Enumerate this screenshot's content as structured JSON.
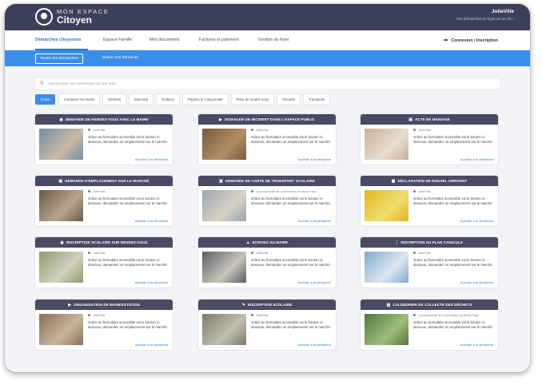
{
  "header": {
    "logo_line1": "MON ESPACE",
    "logo_line2": "Citoyen",
    "town": "JolieVille",
    "town_subtitle": "Vos démarches en ligne en un clic !"
  },
  "nav": {
    "items": [
      "Démarches citoyennes",
      "Espace Famille",
      "Mes documents",
      "Factures et paiement",
      "Gestion du foyer"
    ],
    "active": "Démarches citoyennes",
    "login_label": "Connexion / Inscription"
  },
  "subnav": {
    "tabs": [
      "Toutes les démarches",
      "Suivre une demande"
    ],
    "active": "Toutes les démarches"
  },
  "search": {
    "placeholder": "Rechercher une démarche via son nom"
  },
  "filters": [
    "Toutes",
    "Contacter ma mairie",
    "Déchets",
    "Etat-Civil",
    "Enfance",
    "Papiers et Citoyenneté",
    "Prise de rendez-vous",
    "Sécurité",
    "Transports"
  ],
  "link_label": "Accéder à la démarche",
  "cards": [
    {
      "title": "DEMANDE DE RENDEZ-VOUS AVEC LE MAIRE",
      "icon": "eye-icon",
      "location": "JolieVille",
      "description": "Grâce au formulaire accessible via le bouton ci-dessous, demandez un emplacement sur le marché."
    },
    {
      "title": "SIGNALER UN INCIDENT DANS L'ESPACE PUBLIC",
      "icon": "megaphone-icon",
      "location": "JolieVille",
      "description": "Grâce au formulaire accessible via le bouton ci-dessous, demandez un emplacement sur le marché."
    },
    {
      "title": "ACTE DE MARIAGE",
      "icon": "document-icon",
      "location": "JolieVille",
      "description": "Grâce au formulaire accessible via le bouton ci-dessous, demandez un emplacement sur le marché."
    },
    {
      "title": "DEMANDE D'EMPLACEMENT SUR LE MARCHÉ",
      "icon": "store-icon",
      "location": "JolieVille",
      "description": "Grâce au formulaire accessible via le bouton ci-dessous, demandez un emplacement sur le marché."
    },
    {
      "title": "DEMANDE DE CARTE DE TRANSPORT SCOLAIRE",
      "icon": "bus-icon",
      "location": "Communauté de communes du beau Pays",
      "description": "Grâce au formulaire accessible via le bouton ci-dessous, demandez un emplacement sur le marché."
    },
    {
      "title": "DÉCLARATION DE NOUVEL ARRIVANT",
      "icon": "moving-box-icon",
      "location": "JolieVille",
      "description": "Grâce au formulaire accessible via le bouton ci-dessous, demandez un emplacement sur le marché."
    },
    {
      "title": "INSCRIPTION SCOLAIRE SUR RENDEZ-VOUS",
      "icon": "eye-icon",
      "location": "JolieVille",
      "description": "Grâce au formulaire accessible via le bouton ci-dessous, demandez un emplacement sur le marché."
    },
    {
      "title": "ECRIVEZ AU MAIRE",
      "icon": "townhall-icon",
      "location": "JolieVille",
      "description": "Grâce au formulaire accessible via le bouton ci-dessous, demandez un emplacement sur le marché."
    },
    {
      "title": "INSCRIPTION AU PLAN CANICULE",
      "icon": "thermometer-icon",
      "location": "JolieVille",
      "description": "Grâce au formulaire accessible via le bouton ci-dessous, demandez un emplacement sur le marché."
    },
    {
      "title": "ORGANISATION DE MANIFESTATION",
      "icon": "megaphone-icon",
      "location": "JolieVille",
      "description": "Grâce au formulaire accessible via le bouton ci-dessous, demandez un emplacement sur le marché."
    },
    {
      "title": "INSCRIPTION SCOLAIRE",
      "icon": "pencil-icon",
      "location": "JolieVille",
      "description": "Grâce au formulaire accessible via le bouton ci-dessous, demandez un emplacement sur le marché."
    },
    {
      "title": "CALENDRIER DE COLLECTE DES DÉCHETS",
      "icon": "trash-icon",
      "location": "Communauté de communes du beau Pays",
      "description": "Grâce au formulaire accessible via le bouton ci-dessous, demandez un emplacement sur le marché."
    }
  ],
  "colors": {
    "header": "#3c3f59",
    "accent": "#3a8ee8",
    "link": "#2b78d6",
    "card_header": "#484b63"
  }
}
